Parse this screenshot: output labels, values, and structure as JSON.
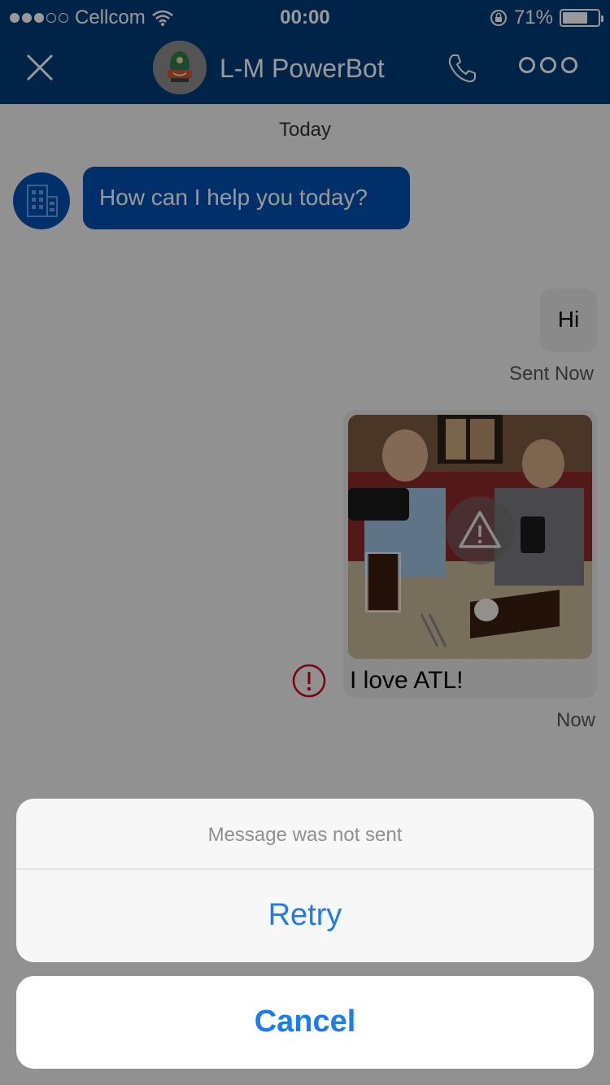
{
  "status_bar": {
    "carrier": "Cellcom",
    "time": "00:00",
    "battery": "71%",
    "battery_level": 0.71
  },
  "header": {
    "title": "L-M PowerBot"
  },
  "chat": {
    "date_separator": "Today",
    "bot_message": "How can I help you today?",
    "user_message_1": "Hi",
    "user_message_1_status": "Sent  Now",
    "user_message_2_caption": "I love ATL!",
    "user_message_2_status": "Now"
  },
  "action_sheet": {
    "message": "Message was not sent",
    "retry_label": "Retry",
    "cancel_label": "Cancel"
  },
  "colors": {
    "header_bg": "#003d79",
    "bot_bubble": "#0050b0",
    "user_bubble": "#e6e6e6",
    "action_blue": "#1a7bf2",
    "error_red": "#d0021b"
  }
}
